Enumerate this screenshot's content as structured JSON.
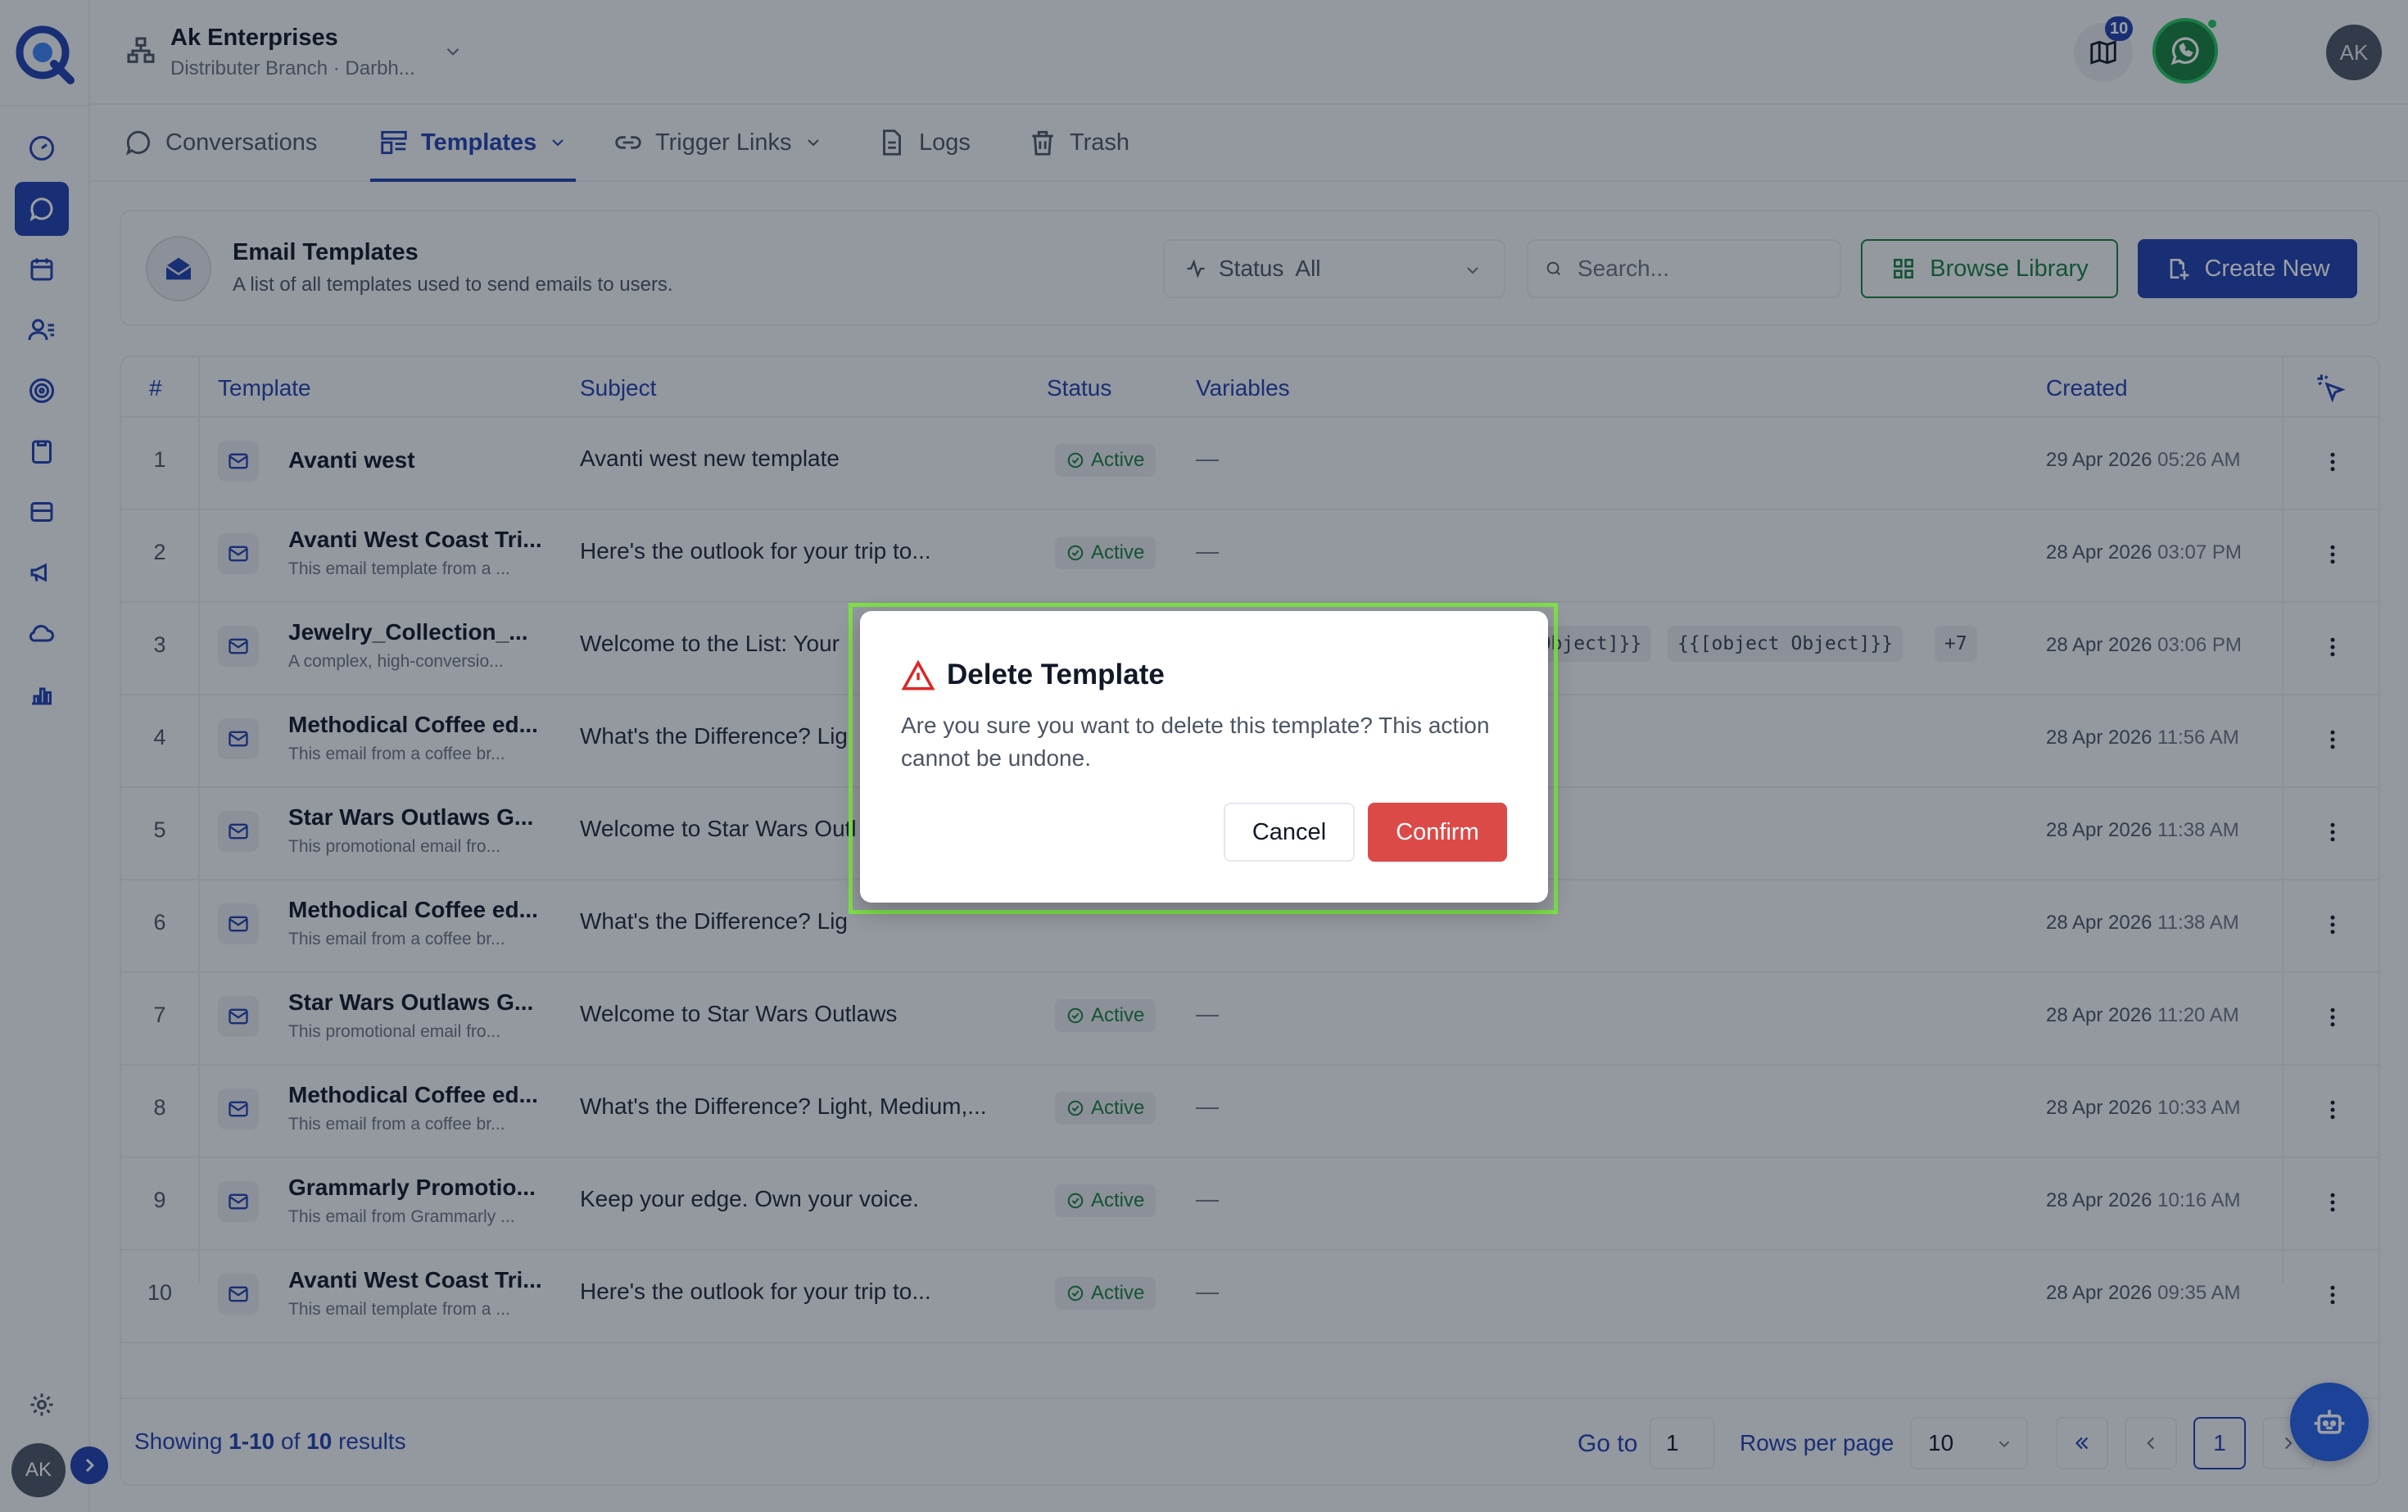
{
  "org": {
    "name": "Ak Enterprises",
    "branch": "Distributer Branch · Darbh..."
  },
  "topbar": {
    "notifications_count": "10",
    "avatar_initials": "AK"
  },
  "sidebar": {
    "avatar_initials": "AK"
  },
  "tabs": [
    {
      "label": "Conversations"
    },
    {
      "label": "Templates"
    },
    {
      "label": "Trigger Links"
    },
    {
      "label": "Logs"
    },
    {
      "label": "Trash"
    }
  ],
  "header": {
    "title": "Email Templates",
    "subtitle": "A list of all templates used to send emails to users.",
    "status_label": "Status",
    "status_value": "All",
    "search_placeholder": "Search...",
    "browse_label": "Browse Library",
    "create_label": "Create New"
  },
  "table": {
    "columns": {
      "num": "#",
      "template": "Template",
      "subject": "Subject",
      "status": "Status",
      "variables": "Variables",
      "created": "Created"
    },
    "rows": [
      {
        "num": "1",
        "name": "Avanti west",
        "desc": "",
        "subject": "Avanti west new template",
        "status": "Active",
        "vars": "—",
        "date": "29 Apr 2026",
        "time": "05:26 AM"
      },
      {
        "num": "2",
        "name": "Avanti West Coast Tri...",
        "desc": "This email template from a ...",
        "subject": "Here's the outlook for your trip to...",
        "status": "Active",
        "vars": "—",
        "date": "28 Apr 2026",
        "time": "03:07 PM"
      },
      {
        "num": "3",
        "name": "Jewelry_Collection_...",
        "desc": "A complex, high-conversio...",
        "subject": "Welcome to the List: Your",
        "status": "",
        "vars": "",
        "chips": [
          "t Object]}}",
          "{{[object Object]}}",
          "+7"
        ],
        "date": "28 Apr 2026",
        "time": "03:06 PM"
      },
      {
        "num": "4",
        "name": "Methodical Coffee ed...",
        "desc": "This email from a coffee br...",
        "subject": "What's the Difference? Lig",
        "status": "",
        "vars": "",
        "date": "28 Apr 2026",
        "time": "11:56 AM"
      },
      {
        "num": "5",
        "name": "Star Wars Outlaws G...",
        "desc": "This promotional email fro...",
        "subject": "Welcome to Star Wars Outl",
        "status": "",
        "vars": "",
        "date": "28 Apr 2026",
        "time": "11:38 AM"
      },
      {
        "num": "6",
        "name": "Methodical Coffee ed...",
        "desc": "This email from a coffee br...",
        "subject": "What's the Difference? Lig",
        "status": "",
        "vars": "",
        "date": "28 Apr 2026",
        "time": "11:38 AM"
      },
      {
        "num": "7",
        "name": "Star Wars Outlaws G...",
        "desc": "This promotional email fro...",
        "subject": "Welcome to Star Wars Outlaws",
        "status": "Active",
        "vars": "—",
        "date": "28 Apr 2026",
        "time": "11:20 AM"
      },
      {
        "num": "8",
        "name": "Methodical Coffee ed...",
        "desc": "This email from a coffee br...",
        "subject": "What's the Difference? Light, Medium,...",
        "status": "Active",
        "vars": "—",
        "date": "28 Apr 2026",
        "time": "10:33 AM"
      },
      {
        "num": "9",
        "name": "Grammarly Promotio...",
        "desc": "This email from Grammarly ...",
        "subject": "Keep your edge. Own your voice.",
        "status": "Active",
        "vars": "—",
        "date": "28 Apr 2026",
        "time": "10:16 AM"
      },
      {
        "num": "10",
        "name": "Avanti West Coast Tri...",
        "desc": "This email template from a ...",
        "subject": "Here's the outlook for your trip to...",
        "status": "Active",
        "vars": "—",
        "date": "28 Apr 2026",
        "time": "09:35 AM"
      }
    ]
  },
  "footer": {
    "showing_prefix": "Showing",
    "showing_range": "1-10",
    "showing_of": "of",
    "showing_total": "10",
    "showing_suffix": "results",
    "goto_label": "Go to",
    "goto_value": "1",
    "rows_per_page_label": "Rows per page",
    "rows_per_page_value": "10",
    "current_page": "1"
  },
  "modal": {
    "title": "Delete Template",
    "message": "Are you sure you want to delete this template? This action cannot be undone.",
    "cancel_label": "Cancel",
    "confirm_label": "Confirm"
  },
  "colors": {
    "brand": "#1e40af",
    "success": "#15803d",
    "danger": "#dc4a48",
    "highlight": "#7ee04a"
  }
}
